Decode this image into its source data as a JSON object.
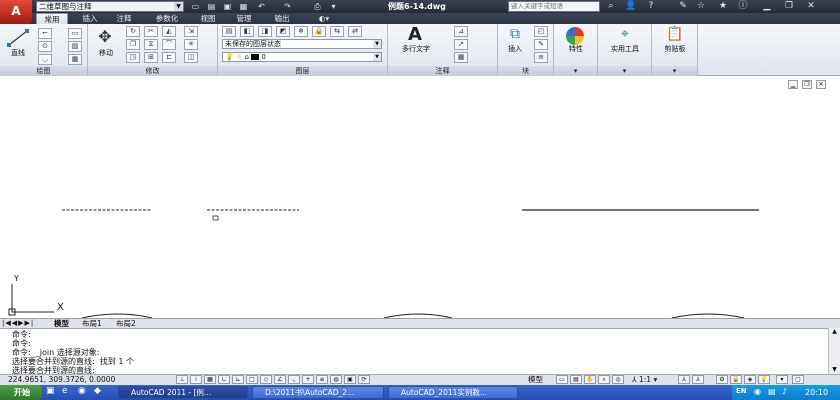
{
  "titlebar": {
    "app_button_label": "A",
    "workspace": "二维草图与注释",
    "doc_title": "例题6-14.dwg",
    "search_placeholder": "键入关键字或短语"
  },
  "tabs": [
    "常用",
    "插入",
    "注释",
    "参数化",
    "视图",
    "管理",
    "输出"
  ],
  "ribbon": {
    "draw": {
      "title": "绘图",
      "line_label": "直线"
    },
    "modify": {
      "title": "修改",
      "move_label": "移动"
    },
    "layers": {
      "title": "图层",
      "layer_state": "未保存的图层状态",
      "current_layer": "0"
    },
    "annotation": {
      "title": "注释",
      "mtext_label": "多行文字"
    },
    "block": {
      "title": "块",
      "insert_label": "插入"
    },
    "properties": {
      "label": "特性"
    },
    "utilities": {
      "label": "实用工具"
    },
    "clipboard": {
      "label": "剪贴板"
    }
  },
  "ucs": {
    "y_label": "Y",
    "x_label": "X"
  },
  "layout_tabs": [
    "模型",
    "布局1",
    "布局2"
  ],
  "command_history": [
    "命令:",
    "命令:",
    "命令:  _join 选择源对象:",
    "选择要合并到源的直线:  找到 1 个",
    "选择要合并到源的直线:"
  ],
  "status": {
    "coordinates": "224.9651, 309.3726, 0.0000",
    "model_label": "模型",
    "annotation_scale": "1:1"
  },
  "taskbar": {
    "start_label": "开始",
    "tasks": [
      "AutoCAD 2011 - [例...",
      "D:\\2011书\\AutoCAD_2...",
      "AutoCAD_2011实例教..."
    ],
    "tray_lang": "EN",
    "clock": "20:10"
  },
  "colors": {
    "titlebar": "#2f3542",
    "app_button": "#c0392b",
    "taskbar": "#2e5cc4",
    "start": "#3a8a36"
  }
}
